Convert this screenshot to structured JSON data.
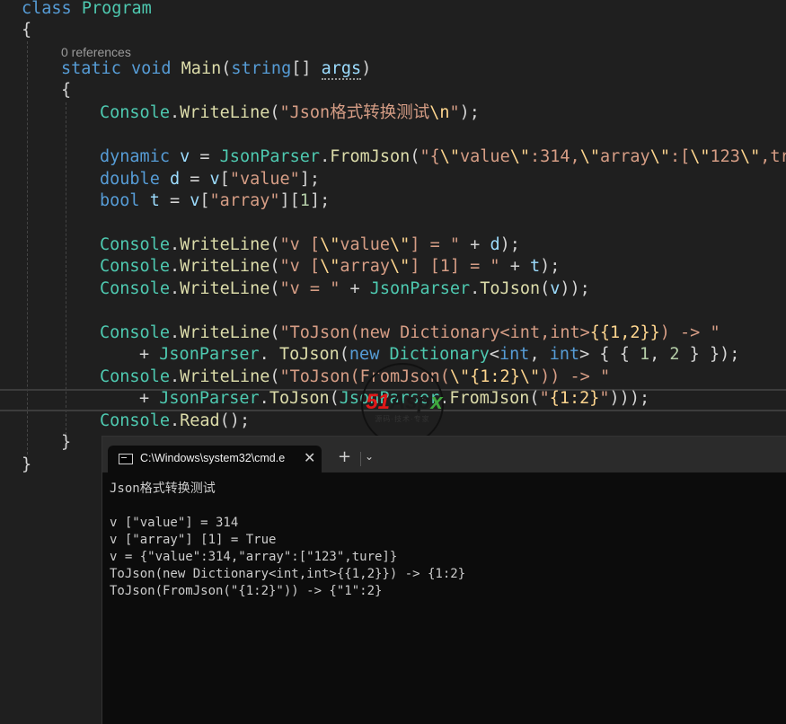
{
  "editor": {
    "codelens": "0 references",
    "code": {
      "l0_kw": "class",
      "l0_name": "Program",
      "l1": "{",
      "l3_kw1": "static",
      "l3_kw2": "void",
      "l3_fn": "Main",
      "l3_p1": "(",
      "l3_ty": "string",
      "l3_p2": "[] ",
      "l3_arg": "args",
      "l3_p3": ")",
      "l4": "{",
      "l5_cls": "Console",
      "l5_dot": ".",
      "l5_fn": "WriteLine",
      "l5_p1": "(",
      "l5_s1": "\"Json格式转换测试",
      "l5_esc": "\\n",
      "l5_s2": "\"",
      "l5_p2": ");",
      "l7_kw": "dynamic",
      "l7_var": " v",
      "l7_eq": " = ",
      "l7_cls": "JsonParser",
      "l7_dot": ".",
      "l7_fn": "FromJson",
      "l7_p1": "(",
      "l7_s1": "\"{",
      "l7_e1": "\\\"",
      "l7_s2": "value",
      "l7_e2": "\\\"",
      "l7_s3": ":314,",
      "l7_e3": "\\\"",
      "l7_s4": "array",
      "l7_e4": "\\\"",
      "l7_s5": ":[",
      "l7_e5": "\\\"",
      "l7_s6": "123",
      "l7_e6": "\\\"",
      "l7_s7": ",tru",
      "l8_kw": "double",
      "l8_var": " d",
      "l8_eq": " = ",
      "l8_v": "v",
      "l8_p1": "[",
      "l8_s": "\"value\"",
      "l8_p2": "];",
      "l9_kw": "bool",
      "l9_var": " t",
      "l9_eq": " = ",
      "l9_v": "v",
      "l9_p1": "[",
      "l9_s": "\"array\"",
      "l9_p2": "][",
      "l9_n": "1",
      "l9_p3": "];",
      "l11_cls": "Console",
      "l11_dot": ".",
      "l11_fn": "WriteLine",
      "l11_p1": "(",
      "l11_s1": "\"v [",
      "l11_e1": "\\\"",
      "l11_s2": "value",
      "l11_e2": "\\\"",
      "l11_s3": "] = \"",
      "l11_plus": " + ",
      "l11_var": "d",
      "l11_p2": ");",
      "l12_cls": "Console",
      "l12_dot": ".",
      "l12_fn": "WriteLine",
      "l12_p1": "(",
      "l12_s1": "\"v [",
      "l12_e1": "\\\"",
      "l12_s2": "array",
      "l12_e2": "\\\"",
      "l12_s3": "] [1] = \"",
      "l12_plus": " + ",
      "l12_var": "t",
      "l12_p2": ");",
      "l13_cls": "Console",
      "l13_dot": ".",
      "l13_fn": "WriteLine",
      "l13_p1": "(",
      "l13_s": "\"v = \"",
      "l13_plus": " + ",
      "l13_cls2": "JsonParser",
      "l13_dot2": ".",
      "l13_fn2": "ToJson",
      "l13_p2": "(",
      "l13_var": "v",
      "l13_p3": "));",
      "l15_cls": "Console",
      "l15_dot": ".",
      "l15_fn": "WriteLine",
      "l15_p1": "(",
      "l15_s": "\"ToJson(new Dictionary<int,int>",
      "l15_e": "{{1,2}}",
      "l15_s2": ") -> \"",
      "l16_plus": "+ ",
      "l16_cls": "JsonParser",
      "l16_dot": ". ",
      "l16_fn": "ToJson",
      "l16_p1": "(",
      "l16_kw": "new",
      "l16_sp": " ",
      "l16_cls2": "Dictionary",
      "l16_lt": "<",
      "l16_kw2": "int",
      "l16_cm": ", ",
      "l16_kw3": "int",
      "l16_gt": "> { { ",
      "l16_n1": "1",
      "l16_cm2": ", ",
      "l16_n2": "2",
      "l16_end": " } });",
      "l17_cls": "Console",
      "l17_dot": ".",
      "l17_fn": "WriteLine",
      "l17_p1": "(",
      "l17_s1": "\"ToJson(FromJson(",
      "l17_e1": "\\\"",
      "l17_e2": "{1:2}",
      "l17_e3": "\\\"",
      "l17_s2": ")) -> \"",
      "l18_plus": "+ ",
      "l18_cls": "JsonParser",
      "l18_dot": ".",
      "l18_fn": "ToJson",
      "l18_p1": "(",
      "l18_cls2": "JsonParser",
      "l18_dot2": ".",
      "l18_fn2": "FromJson",
      "l18_p2": "(",
      "l18_s1": "\"",
      "l18_e": "{1:2}",
      "l18_s2": "\"",
      "l18_p3": ")));",
      "l19_cls": "Console",
      "l19_dot": ".",
      "l19_fn": "Read",
      "l19_p": "();",
      "l20": "}",
      "l21": "}"
    }
  },
  "watermark": {
    "brand_51": "51",
    "brand_asp": "Asp",
    "brand_x": "x",
    "sub": "源码·技术·专家"
  },
  "terminal": {
    "tab_title": "C:\\Windows\\system32\\cmd.e",
    "tab_icon": "cmd-icon",
    "close_glyph": "✕",
    "new_tab_glyph": "+",
    "dropdown_glyph": "⌄",
    "output": [
      "Json格式转换测试",
      "",
      "v [\"value\"] = 314",
      "v [\"array\"] [1] = True",
      "v = {\"value\":314,\"array\":[\"123\",ture]}",
      "ToJson(new Dictionary<int,int>{{1,2}}) -> {1:2}",
      "ToJson(FromJson(\"{1:2}\")) -> {\"1\":2}"
    ]
  },
  "colors": {
    "editor_bg": "#1f1f1f",
    "keyword": "#569cd6",
    "type": "#4ec9b0",
    "method": "#dcdcaa",
    "string": "#d69d85",
    "escape": "#ffd68f",
    "number": "#b5cea8",
    "parameter": "#9cdcfe",
    "console_bg": "#0c0c0c"
  }
}
